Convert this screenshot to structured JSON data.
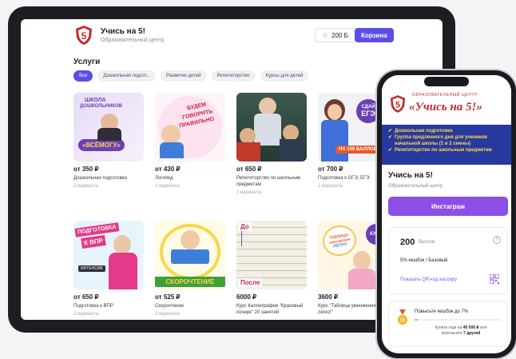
{
  "tablet": {
    "header": {
      "title": "Учись на 5!",
      "subtitle": "Образовательный центр",
      "points": "200 Б.",
      "cart": "Корзина"
    },
    "section_title": "Услуги",
    "filters": [
      {
        "label": "Все",
        "active": true
      },
      {
        "label": "Дошкольная подгот...",
        "active": false
      },
      {
        "label": "Развитие детей",
        "active": false
      },
      {
        "label": "Репетиторство",
        "active": false
      },
      {
        "label": "Курсы для детей",
        "active": false
      }
    ],
    "cards": [
      {
        "price": "от 350 ₽",
        "name": "Дошкольная подготовка",
        "variants": "2 варианта",
        "image_text": [
          "ШКОЛА",
          "ДОШКОЛЬНИКОВ",
          "«ВСЁМОГУ»"
        ]
      },
      {
        "price": "от 430 ₽",
        "name": "Логопед",
        "variants": "2 варианта",
        "image_text": [
          "БУДЕМ",
          "ГОВОРИТЬ",
          "ПРАВИЛЬНО"
        ]
      },
      {
        "price": "от 650 ₽",
        "name": "Репетиторство по школьным предметам",
        "variants": "2 варианта",
        "image_text": []
      },
      {
        "price": "от 700 ₽",
        "name": "Подготовка к ОГЭ, ЕГЭ",
        "variants": "2 варианта",
        "image_text": [
          "СДАЙ",
          "ЕГЭ",
          "НА 100 БАЛЛОВ"
        ]
      },
      {
        "price": "от 650 ₽",
        "name": "Подготовка к ВПР",
        "variants": "2 варианта",
        "image_text": [
          "ПОДГОТОВКА",
          "К ВПР",
          "ИНТЕНСИВ"
        ]
      },
      {
        "price": "от 525 ₽",
        "name": "Скорочтение",
        "variants": "2 варианта",
        "image_text": [
          "СКОРОЧТЕНИЕ"
        ]
      },
      {
        "price": "6000 ₽",
        "name": "Курс Каллиграфии \"Красивый почерк\" 20 занятий",
        "variants": "",
        "image_text": [
          "До",
          "После"
        ]
      },
      {
        "price": "3600 ₽",
        "name": "Курс \"Таблица умножения легко!\"",
        "variants": "",
        "image_text": [
          "ТАБЛИЦА",
          "УМНОЖЕНИЯ",
          "ЛЕГКО!",
          "КУРС"
        ]
      }
    ],
    "logo_text": "5"
  },
  "phone": {
    "banner": {
      "org": "ОБРАЗОВАТЕЛЬНЫЙ ЦЕНТР",
      "name": "«Учись на 5!»",
      "logo_text": "5",
      "bullets": [
        "Дошкольная подготовка",
        "Группа продленного дня для учеников начальной школы (1 и 2 смены)",
        "Репетиторство по школьным предметам"
      ]
    },
    "title": "Учись на 5!",
    "subtitle": "Образовательный центр",
    "instagram": "Инстаграм",
    "bonus": {
      "value": "200",
      "unit": "баллов",
      "info": "?",
      "cashback": "5% кешбэк / Базовый",
      "qr_label": "Показать QR-код кассиру"
    },
    "upgrade": {
      "title": "Повысьте кешбэк до 7%",
      "progress": 0.04,
      "line1_pre": "Купите еще на ",
      "line1_amount": "40 000 ₽",
      "line1_post": " или",
      "line2_pre": "пригласите ",
      "line2_amount": "7 друзей"
    }
  },
  "colors": {
    "accent": "#5b4ee8",
    "instagram": "#8b4fe6",
    "brand_red": "#c62a2a",
    "banner_blue": "#27399e"
  }
}
